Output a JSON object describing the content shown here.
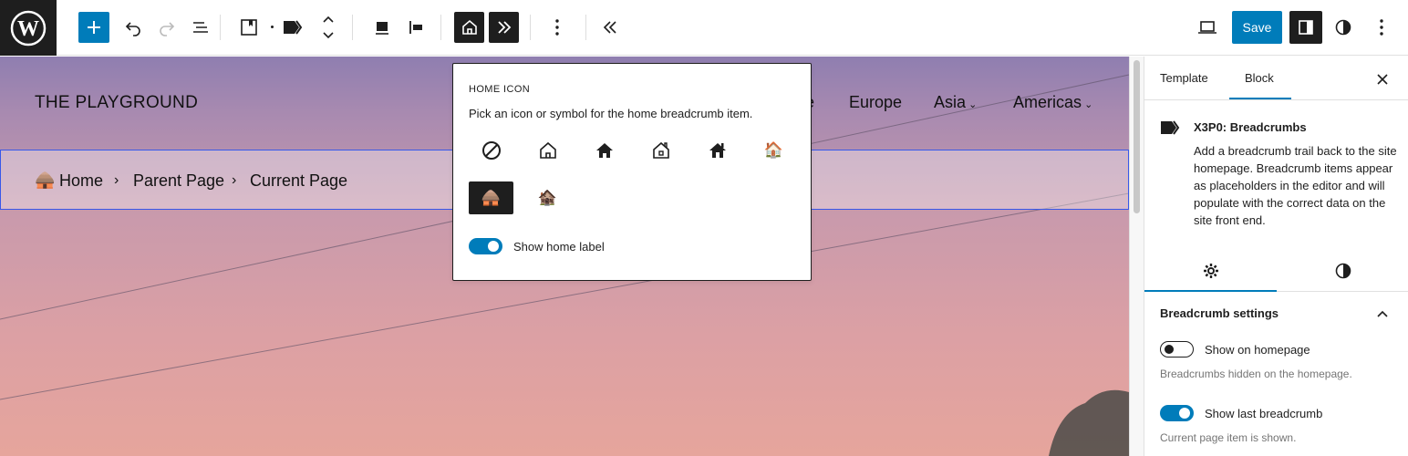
{
  "toolbar": {
    "save_label": "Save",
    "accent_color": "#007cba",
    "icons": [
      "wordpress-logo",
      "add-block-icon",
      "undo-icon",
      "redo-icon",
      "list-view-icon",
      "block-type-icon",
      "breadcrumb-block-icon",
      "move-up-down-icon",
      "align-icon",
      "justify-icon",
      "home-icon",
      "separator-icon",
      "more-options-icon",
      "collapse-icon",
      "preview-device-icon",
      "settings-sidebar-icon",
      "styles-icon",
      "options-icon"
    ]
  },
  "canvas": {
    "site_title": "THE PLAYGROUND",
    "nav": [
      "e",
      "Europe",
      "Asia",
      "Americas"
    ],
    "breadcrumbs": {
      "home_icon": "🛖",
      "items": [
        "Home",
        "Parent Page",
        "Current Page"
      ],
      "separator": "›"
    }
  },
  "popover": {
    "heading": "HOME ICON",
    "description": "Pick an icon or symbol for the home breadcrumb item.",
    "options_row2": [
      "🛖",
      "🏚️"
    ],
    "emoji_option": "🏠",
    "selected_index": 6,
    "toggle_label": "Show home label",
    "toggle_on": true
  },
  "sidebar": {
    "tabs": [
      "Template",
      "Block"
    ],
    "active_tab": "Block",
    "block_name": "X3P0: Breadcrumbs",
    "block_description": "Add a breadcrumb trail back to the site homepage. Breadcrumb items appear as placeholders in the editor and will populate with the correct data on the site front end.",
    "panel_title": "Breadcrumb settings",
    "settings": [
      {
        "label": "Show on homepage",
        "help": "Breadcrumbs hidden on the homepage.",
        "on": false
      },
      {
        "label": "Show last breadcrumb",
        "help": "Current page item is shown.",
        "on": true
      }
    ]
  }
}
